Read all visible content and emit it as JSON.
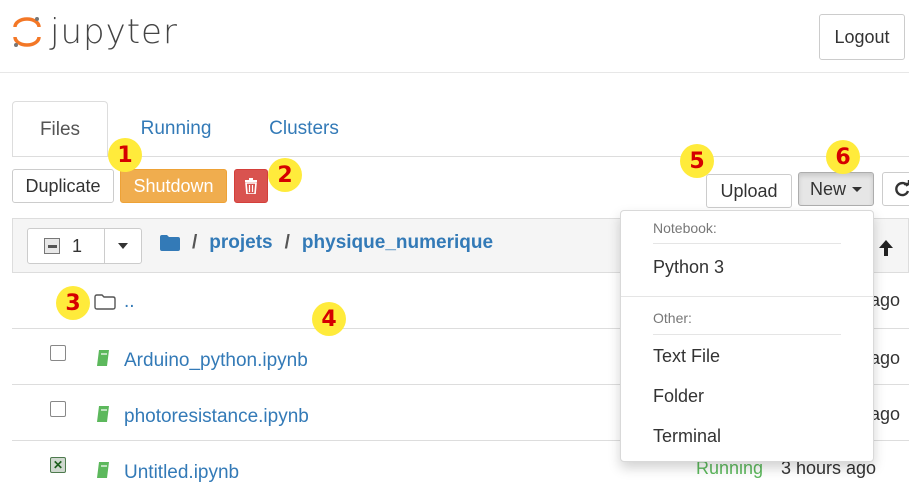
{
  "header": {
    "logo_text": "jupyter",
    "logout_label": "Logout"
  },
  "tabs": [
    {
      "label": "Files",
      "active": true
    },
    {
      "label": "Running",
      "active": false
    },
    {
      "label": "Clusters",
      "active": false
    }
  ],
  "toolbar": {
    "duplicate_label": "Duplicate",
    "shutdown_label": "Shutdown",
    "delete_icon": "trash-icon",
    "upload_label": "Upload",
    "new_label": "New",
    "refresh_icon": "refresh-icon"
  },
  "list_header": {
    "selected_count": "1",
    "breadcrumb": [
      {
        "label": "projets"
      },
      {
        "label": "physique_numerique"
      }
    ],
    "separator": "/"
  },
  "rows": [
    {
      "name": "..",
      "type": "folder",
      "checked": false,
      "status": "",
      "time": "ago"
    },
    {
      "name": "Arduino_python.ipynb",
      "type": "notebook",
      "checked": false,
      "status": "",
      "time": "ago"
    },
    {
      "name": "photoresistance.ipynb",
      "type": "notebook",
      "checked": false,
      "status": "",
      "time": "ago"
    },
    {
      "name": "Untitled.ipynb",
      "type": "notebook",
      "checked": true,
      "status": "Running",
      "time": "3 hours ago"
    }
  ],
  "new_menu": {
    "notebook_header": "Notebook:",
    "notebook_items": [
      "Python 3"
    ],
    "other_header": "Other:",
    "other_items": [
      "Text File",
      "Folder",
      "Terminal"
    ]
  },
  "markers": [
    "1",
    "2",
    "3",
    "4",
    "5",
    "6"
  ],
  "colors": {
    "link": "#337ab7",
    "shutdown": "#f0ad4e",
    "delete": "#d9534f",
    "running": "#5cb85c",
    "marker_bg": "#ffeb3b",
    "marker_text": "#d50000",
    "jupyter_orange": "#f37726"
  }
}
